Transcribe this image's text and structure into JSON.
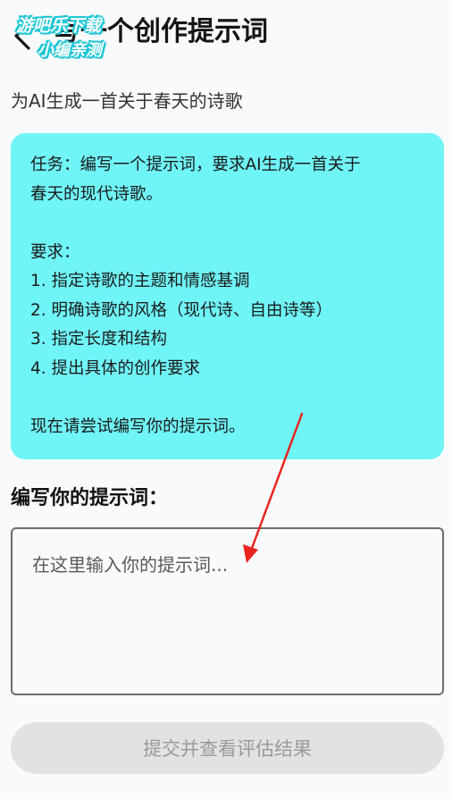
{
  "header": {
    "title": "写一个创作提示词",
    "back_icon": "chevron-left-icon",
    "watermark_line1": "游吧乐下载",
    "watermark_line2": "小编亲测"
  },
  "subtitle": "为AI生成一首关于春天的诗歌",
  "task_card": {
    "background_color": "#70f5f7",
    "lines": [
      "任务：编写一个提示词，要求AI生成一首关于",
      "春天的现代诗歌。",
      "",
      "要求：",
      "1. 指定诗歌的主题和情感基调",
      "2. 明确诗歌的风格（现代诗、自由诗等）",
      "3. 指定长度和结构",
      "4. 提出具体的创作要求",
      "",
      "现在请尝试编写你的提示词。"
    ]
  },
  "prompt_section": {
    "label": "编写你的提示词：",
    "placeholder": "在这里输入你的提示词...",
    "value": ""
  },
  "submit_button": {
    "label": "提交并查看评估结果",
    "state": "disabled"
  },
  "annotation": {
    "color": "#e8251f"
  }
}
